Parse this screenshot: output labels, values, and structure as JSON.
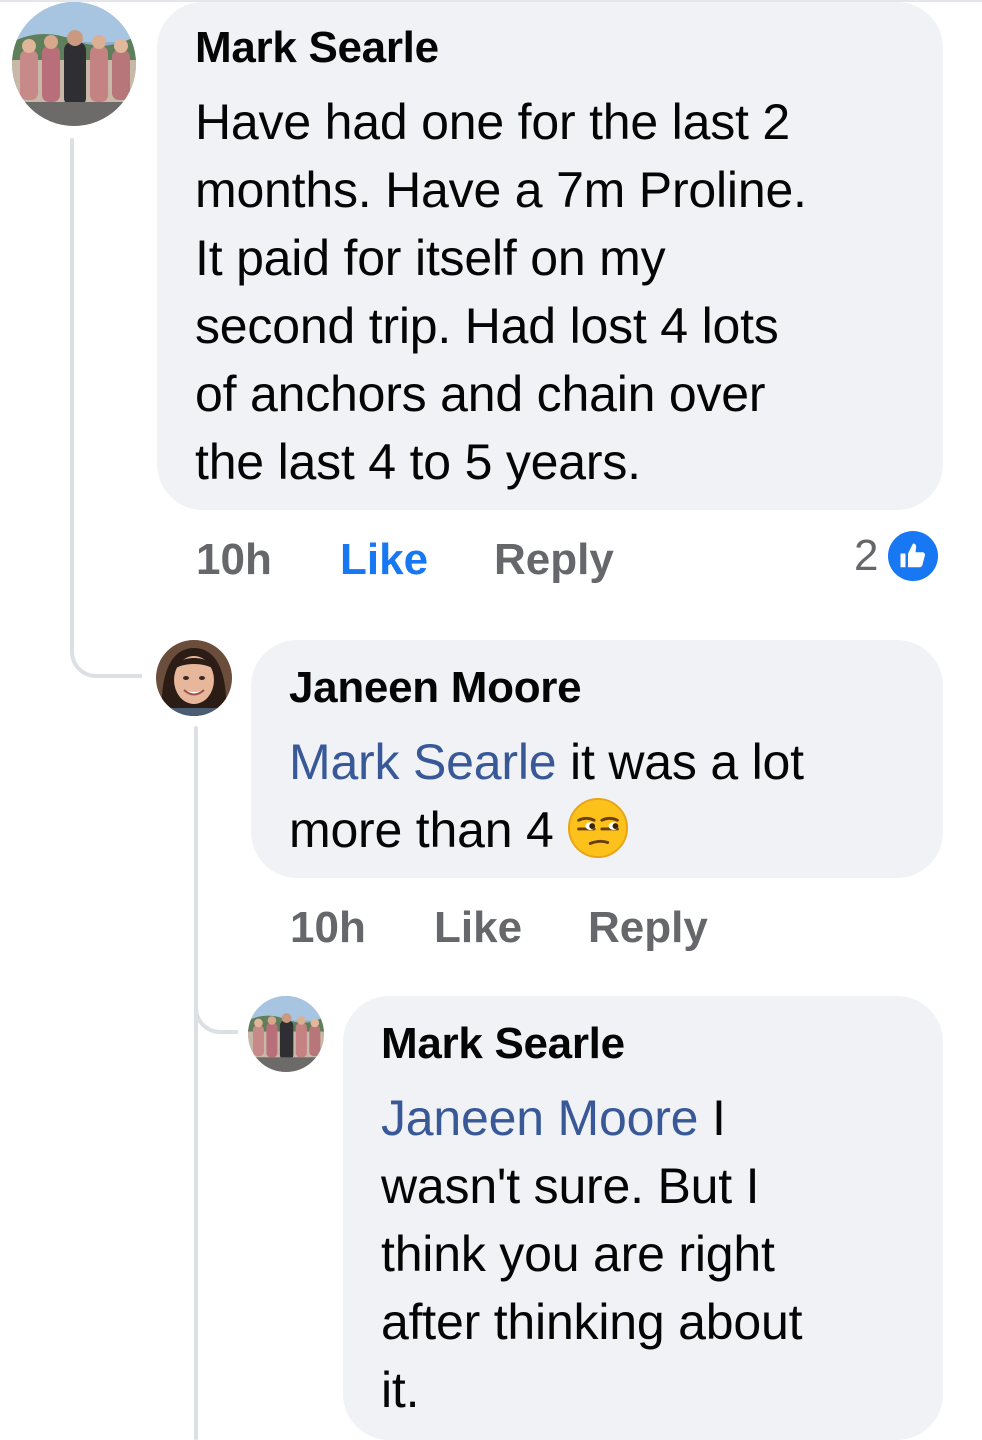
{
  "comments": [
    {
      "author": "Mark Searle",
      "lines": [
        "Have had one for the last 2",
        "months. Have a 7m Proline.",
        "It paid for itself on my",
        "second trip. Had lost 4 lots",
        "of anchors and chain over",
        "the last 4 to 5 years."
      ],
      "time": "10h",
      "like_label": "Like",
      "reply_label": "Reply",
      "reaction_count": "2",
      "reaction_icon": "thumbs-up-icon",
      "like_state": "liked",
      "accent_color": "#1877f2"
    },
    {
      "author": "Janeen Moore",
      "mention": "Mark Searle",
      "line1_rest": " it was a lot",
      "line2": "more than 4 ",
      "emoji": "unamused-face-emoji",
      "time": "10h",
      "like_label": "Like",
      "reply_label": "Reply"
    },
    {
      "author": "Mark Searle",
      "mention": "Janeen Moore",
      "line1_rest": " I",
      "lines": [
        "wasn't sure. But I",
        "think you are right",
        "after thinking about",
        "it."
      ]
    }
  ],
  "colors": {
    "bubble": "#f0f2f5",
    "mention": "#385898",
    "meta": "#65676b",
    "like_active": "#1877f2"
  }
}
